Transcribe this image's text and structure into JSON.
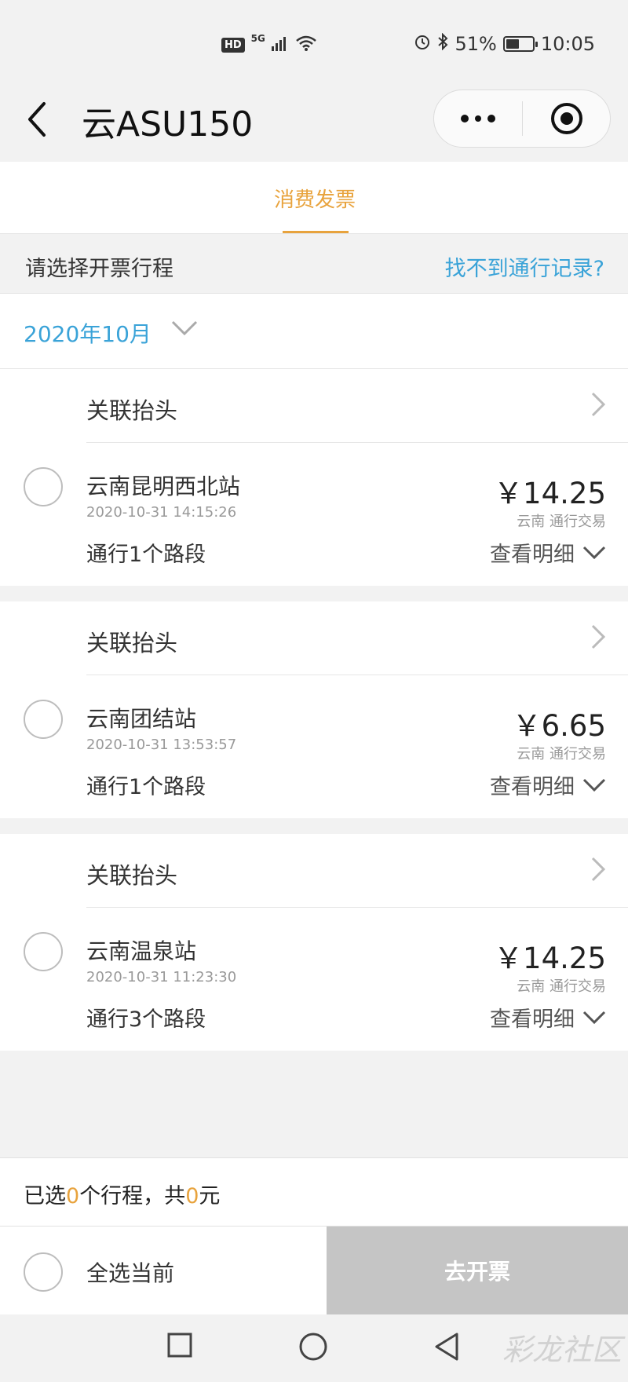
{
  "status_bar": {
    "hd": "HD",
    "network": "5G",
    "battery_percent": "51%",
    "battery_level": 0.51,
    "time": "10:05",
    "icons": [
      "signal-icon",
      "wifi-icon",
      "alarm-icon",
      "bluetooth-icon",
      "battery-icon"
    ]
  },
  "nav": {
    "title": "云ASU150",
    "icons": [
      "back-arrow-icon",
      "more-dots-icon",
      "close-target-icon"
    ]
  },
  "tabs": [
    {
      "label": "消费发票",
      "active": true
    }
  ],
  "section": {
    "title": "请选择开票行程",
    "help_link": "找不到通行记录?"
  },
  "month_filter": {
    "value": "2020年10月"
  },
  "trips": [
    {
      "header_label": "关联抬头",
      "station": "云南昆明西北站",
      "time": "2020-10-31 14:15:26",
      "segments": "通行1个路段",
      "amount": "￥14.25",
      "amount_note": "云南 通行交易",
      "detail_label": "查看明细"
    },
    {
      "header_label": "关联抬头",
      "station": "云南团结站",
      "time": "2020-10-31 13:53:57",
      "segments": "通行1个路段",
      "amount": "￥6.65",
      "amount_note": "云南 通行交易",
      "detail_label": "查看明细"
    },
    {
      "header_label": "关联抬头",
      "station": "云南温泉站",
      "time": "2020-10-31 11:23:30",
      "segments": "通行3个路段",
      "amount": "￥14.25",
      "amount_note": "云南 通行交易",
      "detail_label": "查看明细"
    }
  ],
  "summary": {
    "prefix": "已选",
    "count": "0",
    "middle": "个行程，共",
    "total": "0",
    "suffix": "元"
  },
  "bottom": {
    "select_all_label": "全选当前",
    "issue_button": "去开票"
  },
  "watermark": "彩龙社区",
  "colors": {
    "accent": "#e8a33d",
    "link": "#3aa3d8",
    "disabled_button": "#c5c5c5"
  }
}
